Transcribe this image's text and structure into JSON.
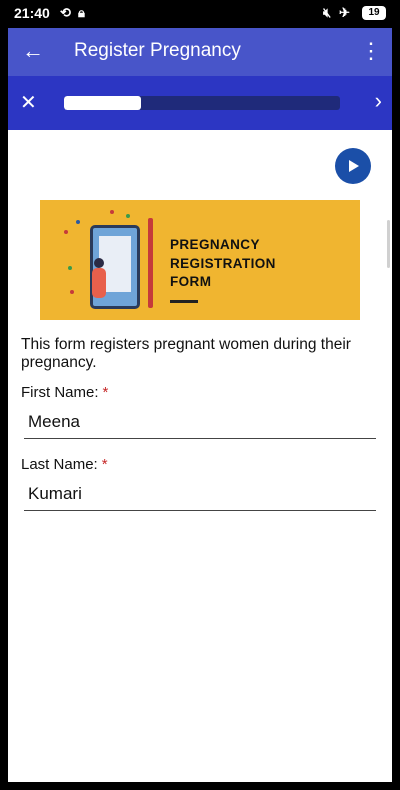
{
  "status_bar": {
    "time": "21:40",
    "battery": "19",
    "icons": [
      "sync-icon",
      "lock-icon",
      "mute-icon",
      "airplane-icon",
      "battery-icon"
    ]
  },
  "app_bar": {
    "title": "Register Pregnancy",
    "back_icon": "arrow-left-icon",
    "menu_icon": "more-vert-icon"
  },
  "nav": {
    "close_icon": "close-icon",
    "next_icon": "chevron-right-icon",
    "progress": 0.28
  },
  "form": {
    "banner_title": "PREGNANCY\nREGISTRATION\nFORM",
    "description": "This form registers pregnant women during their pregnancy.",
    "fields": [
      {
        "label": "First Name:",
        "required_mark": "*",
        "value": "Meena"
      },
      {
        "label": "Last Name:",
        "required_mark": "*",
        "value": "Kumari"
      }
    ]
  },
  "colors": {
    "app_bar": "#4855c9",
    "nav_bar": "#2c36c3",
    "banner": "#f0b530",
    "required": "#c62828",
    "play_button": "#1b4fa8"
  }
}
